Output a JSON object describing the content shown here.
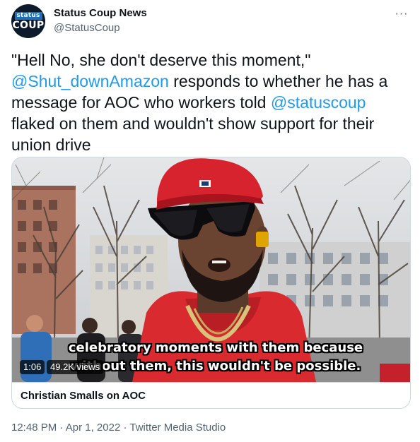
{
  "tweet": {
    "author_name": "Status Coup News",
    "author_handle": "@StatusCoup",
    "avatar_text_top": "status",
    "avatar_text_bottom": "COUP",
    "more_label": "···",
    "text_part1": "\"Hell No, she don't deserve this moment,\" ",
    "mention1": "@Shut_downAmazon",
    "text_part2": " responds to whether he has a message for AOC who workers told ",
    "mention2": "@statuscoup",
    "text_part3": " flaked on them and wouldn't show support for their union drive"
  },
  "media": {
    "caption_line1": "celebratory moments with them because",
    "caption_line2": "without them, this wouldn't be possible.",
    "duration": "1:06",
    "views": "49.2K views",
    "card_title": "Christian Smalls on AOC"
  },
  "footer": {
    "time": "12:48 PM",
    "separator": " · ",
    "date": "Apr 1, 2022",
    "source": "Twitter Media Studio"
  },
  "colors": {
    "link": "#1d9bf0",
    "secondary_text": "#536471",
    "hat_red": "#d7232e",
    "hoodie_red": "#d92a2f"
  }
}
